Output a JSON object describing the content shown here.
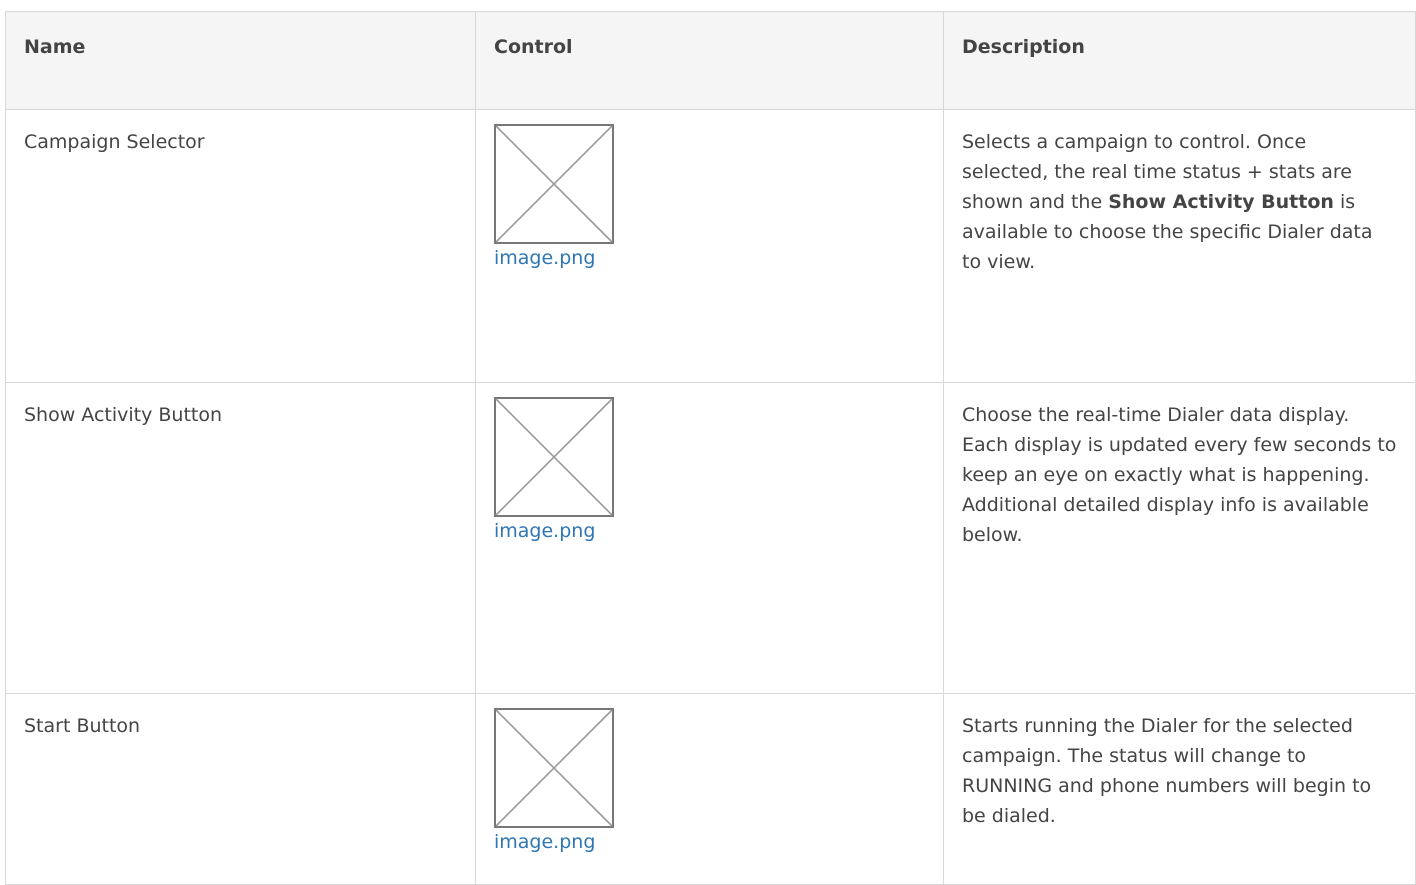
{
  "table": {
    "headers": {
      "name": "Name",
      "control": "Control",
      "description": "Description"
    },
    "rows": [
      {
        "name": "Campaign Selector",
        "control_image": {
          "icon": "broken-image-icon",
          "link": "image.png"
        },
        "description": {
          "before": "Selects a campaign to control. Once selected, the real time status + stats are shown and the ",
          "bold": "Show Activity Button",
          "after": " is available to choose the specific Dialer data to view."
        }
      },
      {
        "name": "Show Activity Button",
        "control_image": {
          "icon": "broken-image-icon",
          "link": "image.png"
        },
        "description": {
          "text": "Choose the real-time Dialer data display. Each display is updated every few seconds to keep an eye on exactly what is happening. Additional detailed display info is available below."
        }
      },
      {
        "name": "Start Button",
        "control_image": {
          "icon": "broken-image-icon",
          "link": "image.png"
        },
        "description": {
          "text": "Starts running the Dialer for the selected campaign. The status will change to RUNNING and phone numbers will begin to be dialed."
        }
      }
    ]
  },
  "colors": {
    "border": "#d8d8d8",
    "header_bg": "#f5f5f5",
    "text": "#444444",
    "link": "#2e76b4",
    "placeholder_stroke": "#777777"
  }
}
